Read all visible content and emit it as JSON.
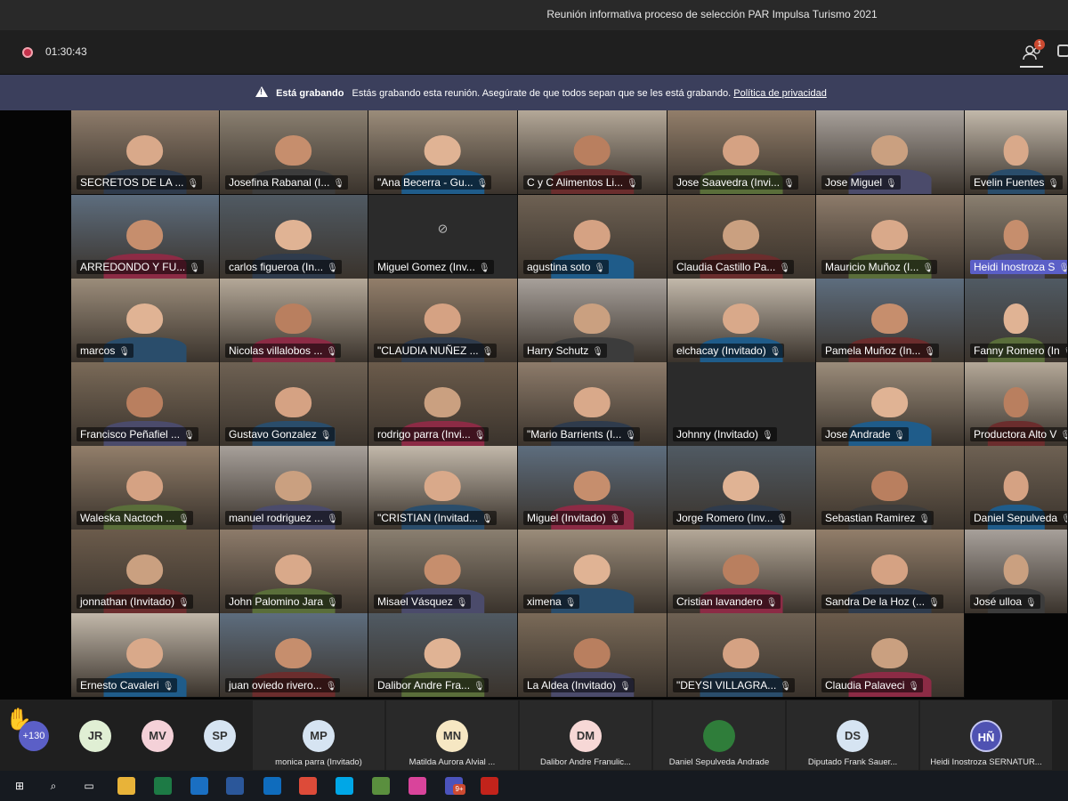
{
  "window": {
    "title": "Reunión informativa proceso de selección PAR Impulsa Turismo 2021"
  },
  "controls": {
    "timer": "01:30:43",
    "people_badge": "1"
  },
  "banner": {
    "bold": "Está grabando",
    "text": "Estás grabando esta reunión. Asegúrate de que todos sepan que se les está grabando.",
    "link": "Política de privacidad"
  },
  "icons": {
    "mic": "🎙"
  },
  "video_tiles": [
    {
      "name": "SECRETOS DE LA ..."
    },
    {
      "name": "Josefina Rabanal (I..."
    },
    {
      "name": "\"Ana Becerra -  Gu..."
    },
    {
      "name": "C y C Alimentos Li..."
    },
    {
      "name": "Jose Saavedra (Invi..."
    },
    {
      "name": "Jose Miguel"
    },
    {
      "name": "Evelin Fuentes"
    },
    {
      "name": "ARREDONDO Y FU..."
    },
    {
      "name": "carlos figueroa (In..."
    },
    {
      "name": "Miguel Gomez (Inv..."
    },
    {
      "name": "agustina soto"
    },
    {
      "name": "Claudia Castillo Pa..."
    },
    {
      "name": "Mauricio Muñoz (I..."
    },
    {
      "name": "Heidi Inostroza S"
    },
    {
      "name": "marcos"
    },
    {
      "name": "Nicolas villalobos ..."
    },
    {
      "name": "\"CLAUDIA NUÑEZ ..."
    },
    {
      "name": "Harry Schutz"
    },
    {
      "name": "elchacay (Invitado)"
    },
    {
      "name": "Pamela Muñoz (In..."
    },
    {
      "name": "Fanny Romero (In"
    },
    {
      "name": "Francisco Peñafiel ..."
    },
    {
      "name": "Gustavo Gonzalez"
    },
    {
      "name": "rodrigo parra (Invi..."
    },
    {
      "name": "\"Mario Barrients (I..."
    },
    {
      "name": "Johnny (Invitado)"
    },
    {
      "name": "Jose Andrade"
    },
    {
      "name": "Productora Alto V"
    },
    {
      "name": "Waleska Nactoch ..."
    },
    {
      "name": "manuel rodriguez ..."
    },
    {
      "name": "\"CRISTIAN (Invitad..."
    },
    {
      "name": "Miguel (Invitado)"
    },
    {
      "name": "Jorge Romero (Inv..."
    },
    {
      "name": "Sebastian Ramirez"
    },
    {
      "name": "Daniel Sepulveda"
    },
    {
      "name": "jonnathan (Invitado)"
    },
    {
      "name": "John Palomino Jara"
    },
    {
      "name": "Misael Vásquez"
    },
    {
      "name": "ximena"
    },
    {
      "name": "Cristian lavandero"
    },
    {
      "name": "Sandra De la Hoz (..."
    },
    {
      "name": "José ulloa"
    },
    {
      "name": "Ernesto Cavaleri"
    },
    {
      "name": "juan oviedo rivero..."
    },
    {
      "name": "Dalibor Andre Fra..."
    },
    {
      "name": "La Aldea (Invitado)"
    },
    {
      "name": "\"DEYSI VILLAGRA..."
    },
    {
      "name": "Claudia  Palaveci"
    }
  ],
  "strip": {
    "more_count": "+130",
    "small_avatars": [
      {
        "initials": "JR",
        "color": "#e0efd4"
      },
      {
        "initials": "MV",
        "color": "#f4d1d8"
      },
      {
        "initials": "SP",
        "color": "#d6e4f2"
      }
    ],
    "participants": [
      {
        "initials": "MP",
        "name": "monica parra (Invitado)",
        "color": "#d6e4f2"
      },
      {
        "initials": "MN",
        "name": "Matilda Aurora Alvial ...",
        "color": "#f6e7c3"
      },
      {
        "initials": "DM",
        "name": "Dalibor Andre Franulic...",
        "color": "#f7d8d6"
      },
      {
        "initials": "",
        "name": "Daniel Sepulveda Andrade",
        "color": "#2f7d3a"
      },
      {
        "initials": "DS",
        "name": "Diputado Frank Sauer...",
        "color": "#d6e4f2"
      },
      {
        "initials": "HÑ",
        "name": "Heidi Inostroza SERNATUR...",
        "color": "#4f52b2"
      }
    ]
  },
  "taskbar": {
    "items": [
      "windows-start",
      "search",
      "task-view",
      "file-explorer",
      "excel",
      "internet-explorer",
      "word",
      "outlook",
      "chrome",
      "skype",
      "photos",
      "itunes",
      "teams",
      "acrobat"
    ],
    "teams_badge": "9+"
  }
}
